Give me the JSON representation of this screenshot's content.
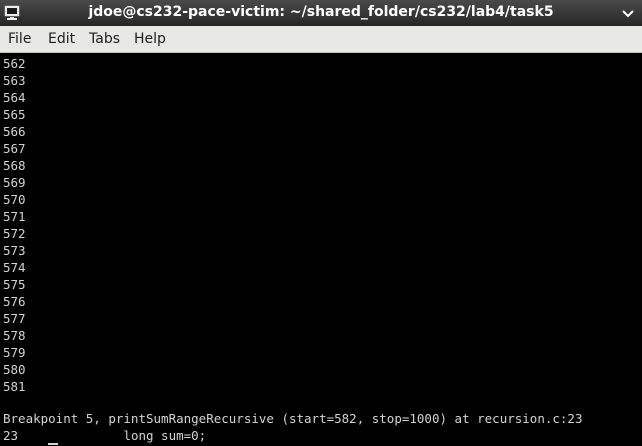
{
  "window": {
    "title": "jdoe@cs232-pace-victim: ~/shared_folder/cs232/lab4/task5",
    "app_icon": "terminal-icon",
    "control_icon": "chevron-down-icon"
  },
  "menu": {
    "items": [
      "File",
      "Edit",
      "Tabs",
      "Help"
    ]
  },
  "terminal": {
    "lines": [
      "562",
      "563",
      "564",
      "565",
      "566",
      "567",
      "568",
      "569",
      "570",
      "571",
      "572",
      "573",
      "574",
      "575",
      "576",
      "577",
      "578",
      "579",
      "580",
      "581"
    ],
    "output": [
      "Breakpoint 5, printSumRangeRecursive (start=582, stop=1000) at recursion.c:23",
      "23\t\tlong sum=0;"
    ]
  },
  "colors": {
    "background": "#000000",
    "foreground": "#d3d3d3",
    "titlebar": "#333333",
    "menubar": "#e8e8e7"
  }
}
